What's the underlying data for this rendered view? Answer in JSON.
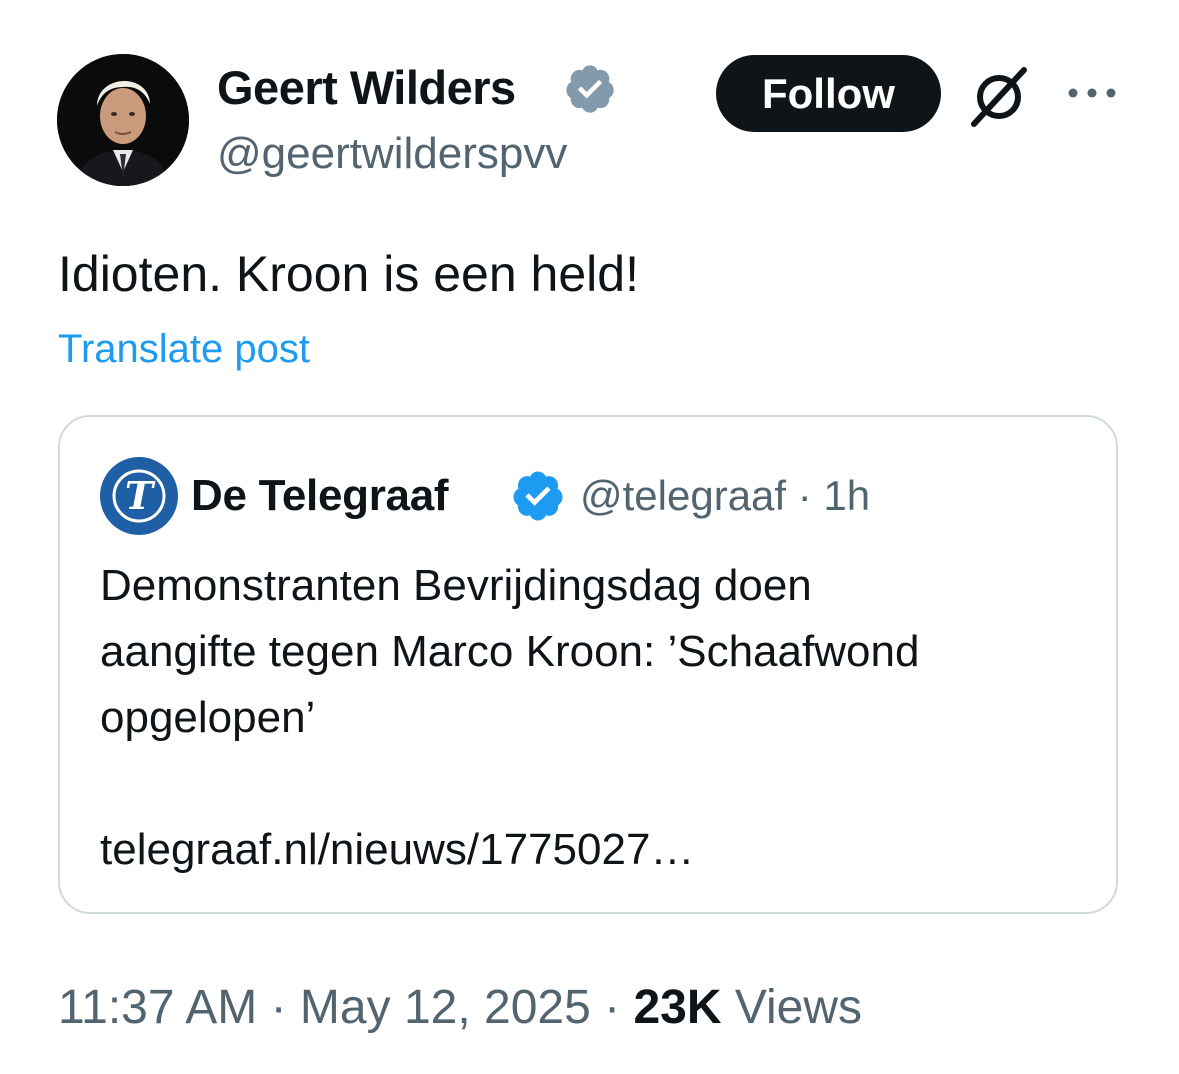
{
  "post": {
    "author": {
      "name": "Geert Wilders",
      "handle": "@geertwilderspvv",
      "verified": true,
      "avatar_icon": "profile-photo"
    },
    "follow_label": "Follow",
    "text": "Idioten. Kroon is een held!",
    "translate_label": "Translate post",
    "timestamp": "11:37 AM",
    "separator": "·",
    "date": "May 12, 2025",
    "views_count": "23K",
    "views_label": "Views"
  },
  "quote": {
    "name": "De Telegraaf",
    "handle": "@telegraaf",
    "age": "1h",
    "meta": "@telegraaf · 1h",
    "verified": true,
    "avatar_icon": "telegraaf-logo",
    "text": "Demonstranten Bevrijdingsdag doen\naangifte tegen Marco Kroon: ’Schaafwond\nopgelopen’\n\ntelegraaf.nl/nieuws/1775027…"
  },
  "colors": {
    "primary_text": "#0f1419",
    "secondary_text": "#536471",
    "link": "#1d9bf0",
    "verified_badge_author": "#829aab",
    "verified_badge_quote": "#1d9bf0",
    "border": "#cfd9de",
    "telegraaf_blue": "#1f5fa6"
  }
}
